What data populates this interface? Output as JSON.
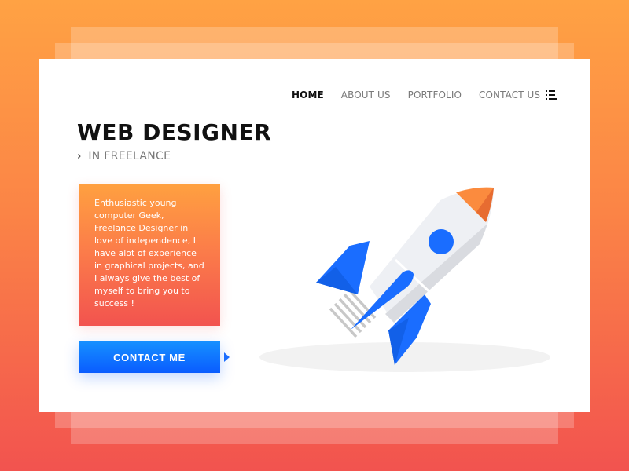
{
  "nav": {
    "items": [
      {
        "label": "HOME",
        "active": true
      },
      {
        "label": "ABOUT US",
        "active": false
      },
      {
        "label": "PORTFOLIO",
        "active": false
      },
      {
        "label": "CONTACT US",
        "active": false
      }
    ],
    "menu_icon": "list-menu-icon"
  },
  "hero": {
    "title": "WEB DESIGNER",
    "subtitle_icon": "chevron-right-icon",
    "subtitle": "IN FREELANCE"
  },
  "about": {
    "text": "Enthusiastic young computer Geek, Freelance Designer in love of independence, I have alot of experience in graphical projects, and I always give the best of myself to bring you to success !"
  },
  "cta": {
    "label": "CONTACT ME",
    "arrow_icon": "triangle-right-icon"
  },
  "illustration": {
    "name": "rocket-illustration"
  },
  "colors": {
    "accent_blue": "#0a5cff",
    "gradient_orange": "#ffa244",
    "gradient_red": "#f2534f",
    "rocket_body": "#eef0f4",
    "rocket_window": "#1a6dff",
    "rocket_nose": "#fb8b3e"
  }
}
